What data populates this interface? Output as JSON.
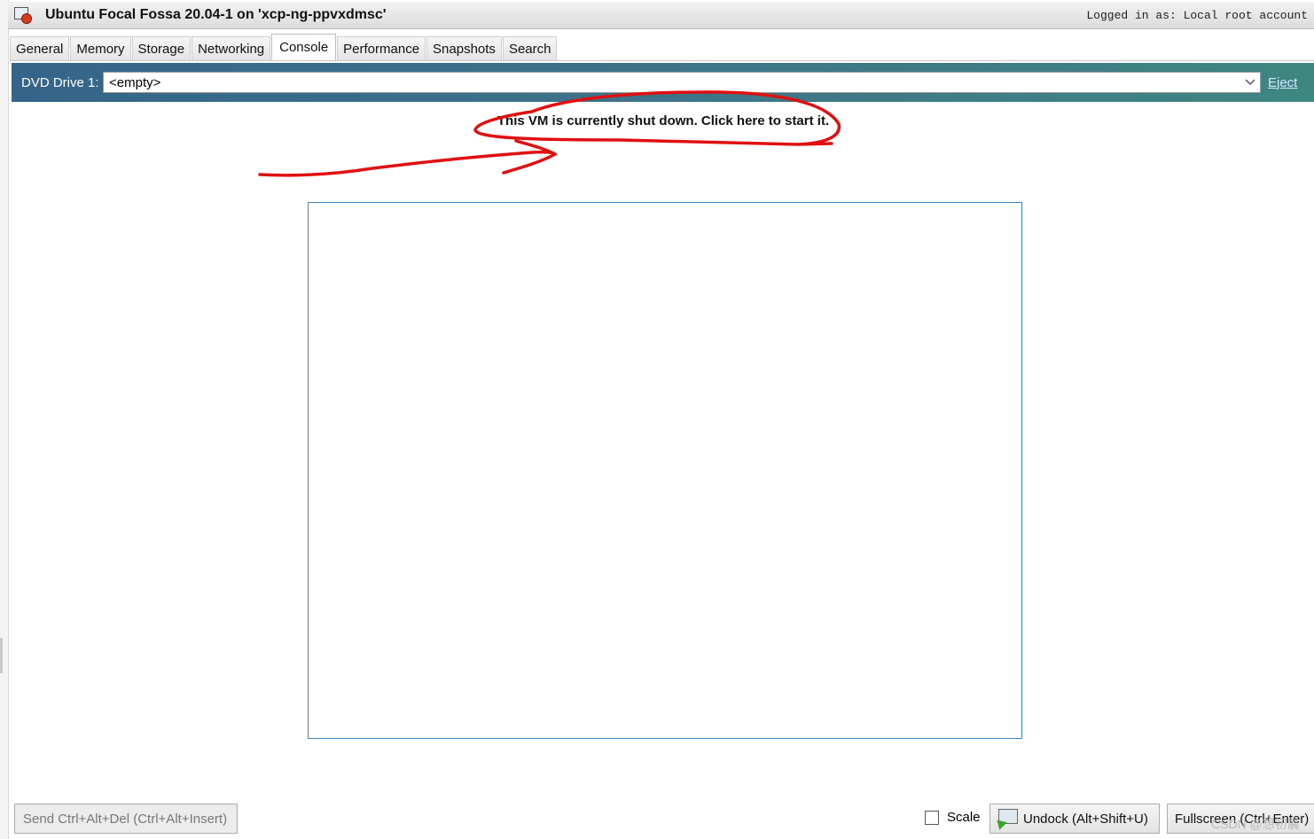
{
  "window": {
    "title": "Ubuntu Focal Fossa 20.04-1 on 'xcp-ng-ppvxdmsc'",
    "login_status": "Logged in as: Local root account",
    "icon": "vm-stopped-icon"
  },
  "tabs": [
    {
      "label": "General"
    },
    {
      "label": "Memory"
    },
    {
      "label": "Storage"
    },
    {
      "label": "Networking"
    },
    {
      "label": "Console",
      "active": true
    },
    {
      "label": "Performance"
    },
    {
      "label": "Snapshots"
    },
    {
      "label": "Search"
    }
  ],
  "dvd": {
    "label": "DVD Drive 1:",
    "selected": "<empty>",
    "eject_label": "Eject"
  },
  "console": {
    "shutdown_message": "This VM is currently shut down.  Click here to start it."
  },
  "bottom_bar": {
    "send_cad_label": "Send Ctrl+Alt+Del (Ctrl+Alt+Insert)",
    "scale_label": "Scale",
    "scale_checked": false,
    "undock_label": "Undock (Alt+Shift+U)",
    "fullscreen_label": "Fullscreen (Ctrl+Enter)"
  },
  "watermark": "CSDN @想初晨",
  "colors": {
    "annotation": "#e01010",
    "dvd_bar_left": "#35648a",
    "dvd_bar_right": "#3f8681",
    "console_border": "#3c86c8"
  }
}
